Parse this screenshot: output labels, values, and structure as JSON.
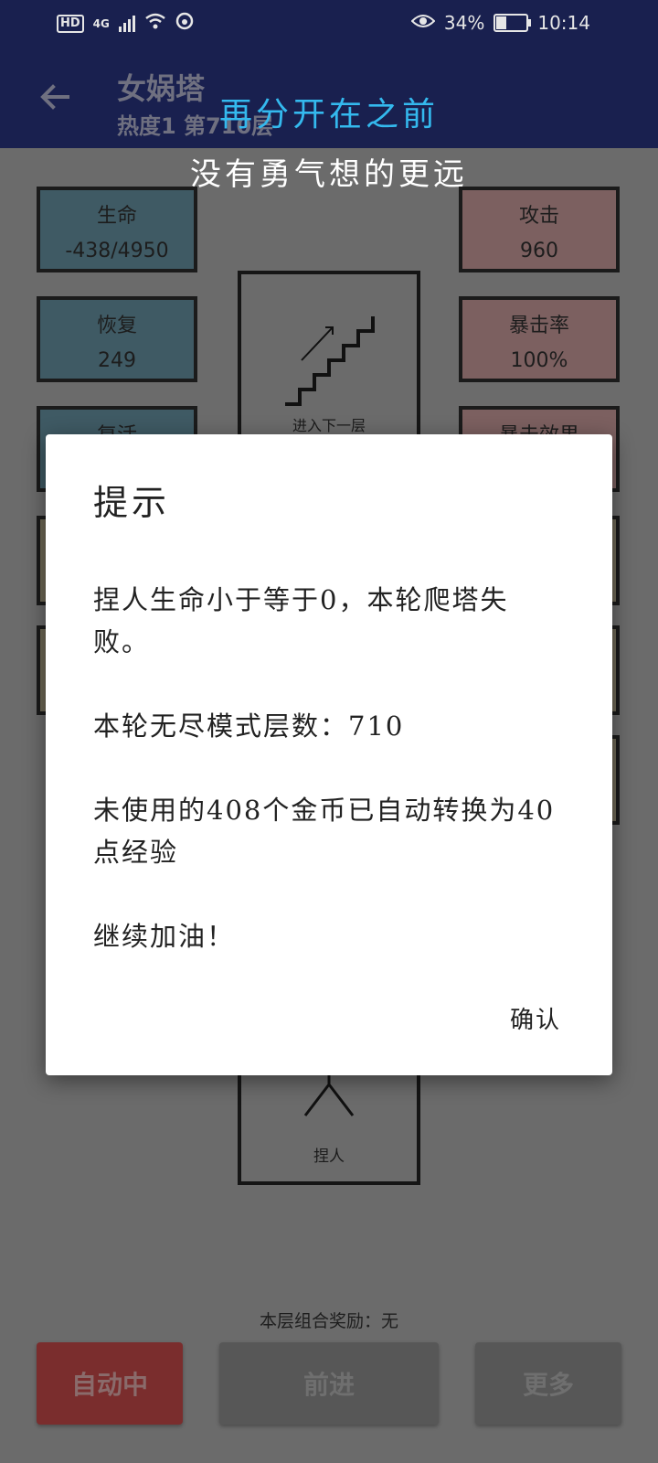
{
  "status_bar": {
    "hd": "HD",
    "network": "4G",
    "battery_percent": "34%",
    "battery_level": 0.34,
    "time": "10:14"
  },
  "app_bar": {
    "title": "女娲塔",
    "subtitle": "热度1 第710层"
  },
  "lyrics": {
    "line1": "再分开在之前",
    "line2": "没有勇气想的更远"
  },
  "stats_left": [
    {
      "label": "生命",
      "value": "-438/4950"
    },
    {
      "label": "恢复",
      "value": "249"
    },
    {
      "label": "复活",
      "value": ""
    }
  ],
  "stats_right": [
    {
      "label": "攻击",
      "value": "960"
    },
    {
      "label": "暴击率",
      "value": "100%"
    },
    {
      "label": "暴击效果",
      "value": ""
    }
  ],
  "stairs": {
    "label": "进入下一层"
  },
  "player": {
    "label": "捏人"
  },
  "reward_text": "本层组合奖励：无",
  "buttons": {
    "auto": "自动中",
    "forward": "前进",
    "more": "更多"
  },
  "dialog": {
    "title": "提示",
    "para1": "捏人生命小于等于0，本轮爬塔失败。",
    "para2": "本轮无尽模式层数：710",
    "para3": "未使用的408个金币已自动转换为40点经验",
    "para4": "继续加油！",
    "confirm": "确认"
  },
  "colors": {
    "appbar": "#19204f",
    "lyric_highlight": "#34b9ee",
    "auto_button": "#7a2d2d"
  }
}
